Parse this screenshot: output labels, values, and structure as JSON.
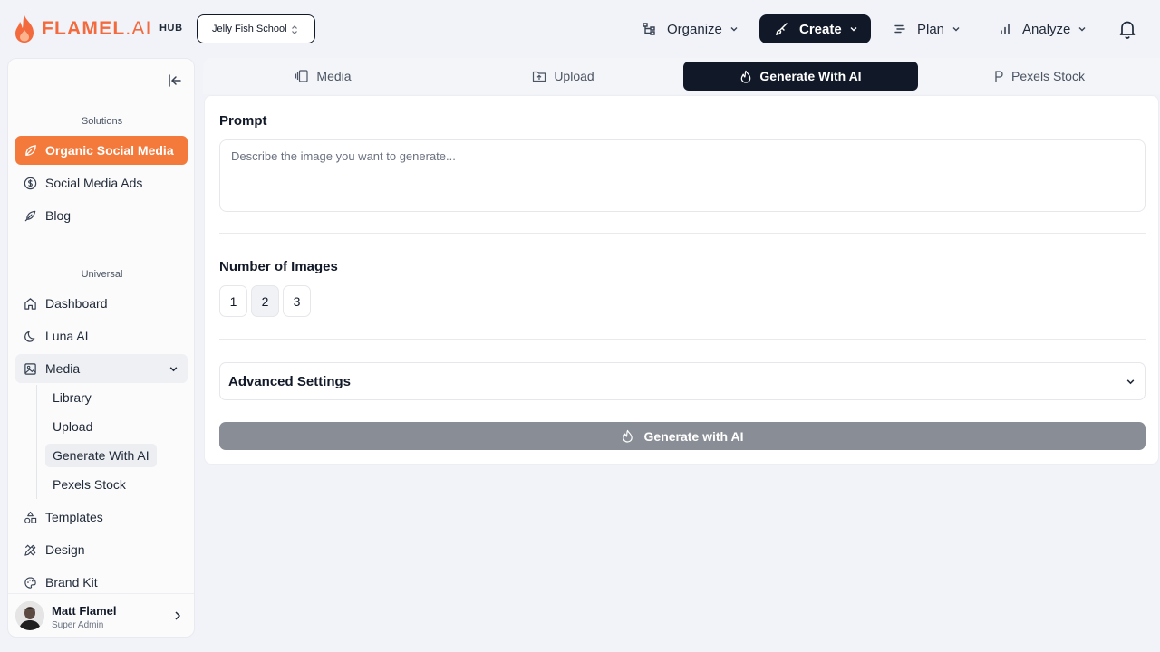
{
  "brand": {
    "name_main": "FLAMEL",
    "name_suffix": ".AI",
    "hub_label": "HUB"
  },
  "workspace": {
    "selected": "Jelly Fish School"
  },
  "nav": {
    "organize": "Organize",
    "create": "Create",
    "plan": "Plan",
    "analyze": "Analyze"
  },
  "sidebar": {
    "solutions_title": "Solutions",
    "solutions": [
      {
        "label": "Organic Social Media",
        "icon": "leaf-icon",
        "active": true
      },
      {
        "label": "Social Media Ads",
        "icon": "dollar-circle-icon"
      },
      {
        "label": "Blog",
        "icon": "feather-icon"
      }
    ],
    "universal_title": "Universal",
    "universal": [
      {
        "label": "Dashboard",
        "icon": "home-icon"
      },
      {
        "label": "Luna AI",
        "icon": "moon-icon"
      },
      {
        "label": "Media",
        "icon": "image-icon",
        "expanded": true
      }
    ],
    "media_sub": [
      {
        "label": "Library"
      },
      {
        "label": "Upload"
      },
      {
        "label": "Generate With AI",
        "current": true
      },
      {
        "label": "Pexels Stock"
      }
    ],
    "more": [
      {
        "label": "Templates",
        "icon": "shapes-icon"
      },
      {
        "label": "Design",
        "icon": "pencil-ruler-icon"
      },
      {
        "label": "Brand Kit",
        "icon": "palette-icon"
      }
    ],
    "user": {
      "name": "Matt Flamel",
      "role": "Super Admin"
    }
  },
  "tabs": [
    {
      "label": "Media",
      "icon": "gallery-icon"
    },
    {
      "label": "Upload",
      "icon": "folder-upload-icon"
    },
    {
      "label": "Generate With AI",
      "icon": "flame-icon",
      "active": true
    },
    {
      "label": "Pexels Stock",
      "icon": "pexels-icon"
    }
  ],
  "main": {
    "prompt_label": "Prompt",
    "prompt_placeholder": "Describe the image you want to generate...",
    "prompt_value": "",
    "num_images_label": "Number of Images",
    "num_options": [
      "1",
      "2",
      "3"
    ],
    "num_selected": "2",
    "advanced_label": "Advanced Settings",
    "generate_label": "Generate with AI"
  },
  "colors": {
    "brand_orange": "#f47a3c",
    "dark": "#111827",
    "disabled_button": "#898d96"
  }
}
